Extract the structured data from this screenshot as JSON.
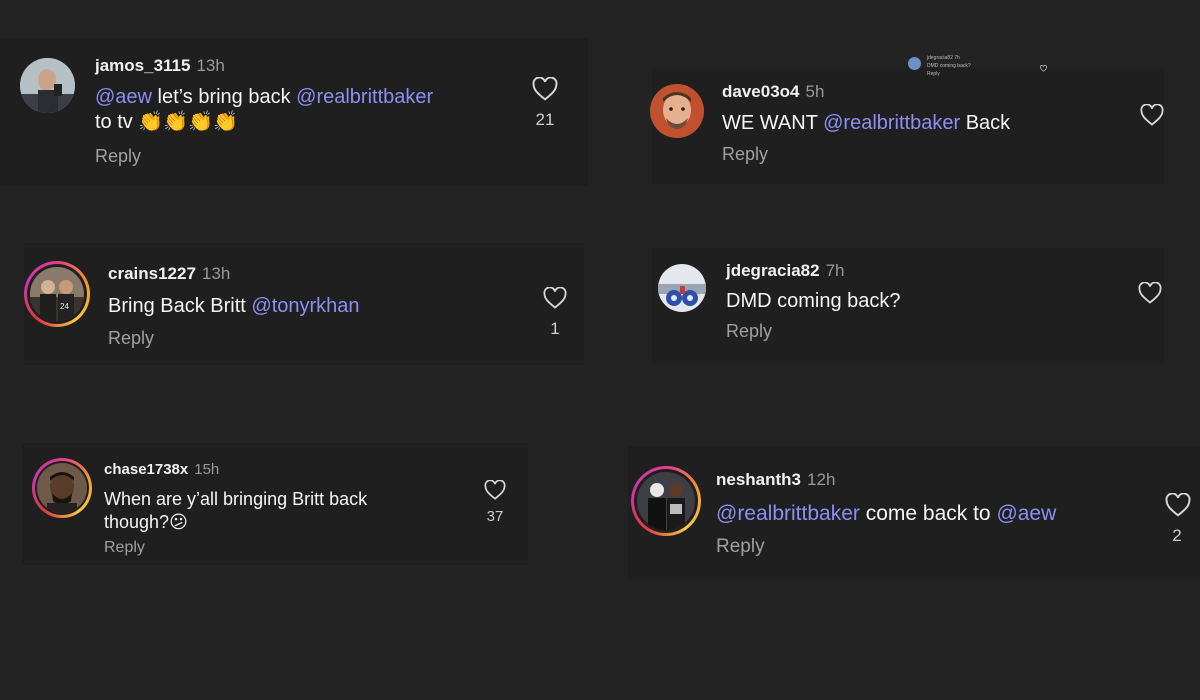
{
  "comments": [
    {
      "username": "jamos_3115",
      "time": "13h",
      "text_parts": [
        {
          "type": "mention",
          "text": "@aew"
        },
        {
          "type": "text",
          "text": " let’s bring back "
        },
        {
          "type": "mention",
          "text": "@realbrittbaker"
        },
        {
          "type": "break"
        },
        {
          "type": "text",
          "text": "to tv "
        },
        {
          "type": "emoji",
          "text": "👏👏👏👏"
        }
      ],
      "reply": "Reply",
      "likes": "21"
    },
    {
      "username": "dave03o4",
      "time": "5h",
      "text_parts": [
        {
          "type": "text",
          "text": "WE WANT "
        },
        {
          "type": "mention",
          "text": "@realbrittbaker"
        },
        {
          "type": "text",
          "text": "  Back"
        }
      ],
      "reply": "Reply",
      "likes": ""
    },
    {
      "username": "crains1227",
      "time": "13h",
      "text_parts": [
        {
          "type": "text",
          "text": "Bring Back Britt "
        },
        {
          "type": "mention",
          "text": "@tonyrkhan"
        }
      ],
      "reply": "Reply",
      "likes": "1"
    },
    {
      "username": "jdegracia82",
      "time": "7h",
      "text_parts": [
        {
          "type": "text",
          "text": "DMD coming back?"
        }
      ],
      "reply": "Reply",
      "likes": ""
    },
    {
      "username": "chase1738x",
      "time": "15h",
      "text_parts": [
        {
          "type": "text",
          "text": "When are y’all bringing Britt back"
        },
        {
          "type": "break"
        },
        {
          "type": "text",
          "text": "though?"
        },
        {
          "type": "emoji",
          "text": "😕"
        }
      ],
      "reply": "Reply",
      "likes": "37"
    },
    {
      "username": "neshanth3",
      "time": "12h",
      "text_parts": [
        {
          "type": "mention",
          "text": "@realbrittbaker"
        },
        {
          "type": "text",
          "text": " come back to "
        },
        {
          "type": "mention",
          "text": "@aew"
        }
      ],
      "reply": "Reply",
      "likes": "2"
    }
  ],
  "preview": {
    "username": "jdegracia82",
    "time": "7h",
    "text": "DMD coming back?",
    "reply": "Reply"
  },
  "colors": {
    "background": "#232323",
    "card": "#1f1f20",
    "mention": "#8d8ff2",
    "muted": "#a0a0a0"
  }
}
